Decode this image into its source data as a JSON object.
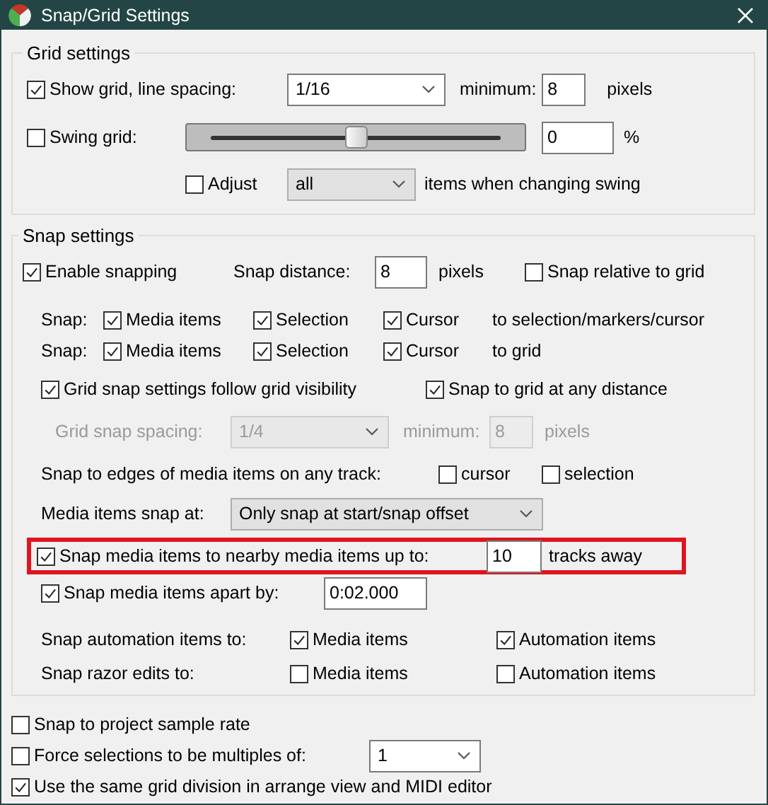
{
  "window": {
    "title": "Snap/Grid Settings"
  },
  "grid_settings": {
    "title": "Grid settings",
    "show_grid": {
      "label": "Show grid, line spacing:",
      "checked": true,
      "spacing": "1/16",
      "minimum_label": "minimum:",
      "minimum": "8",
      "unit": "pixels"
    },
    "swing": {
      "label": "Swing grid:",
      "checked": false,
      "level": 0.5,
      "value": "0",
      "unit": "%"
    },
    "adjust": {
      "label": "Adjust",
      "checked": false,
      "scope": "all",
      "suffix": "items when changing swing"
    }
  },
  "snap_settings": {
    "title": "Snap settings",
    "enable": {
      "label": "Enable snapping",
      "checked": true
    },
    "distance": {
      "label": "Snap distance:",
      "value": "8",
      "unit": "pixels"
    },
    "relative": {
      "label": "Snap relative to grid",
      "checked": false
    },
    "snap_rows": [
      {
        "label": "Snap:",
        "options": [
          {
            "label": "Media items",
            "checked": true
          },
          {
            "label": "Selection",
            "checked": true
          },
          {
            "label": "Cursor",
            "checked": true
          }
        ],
        "target": "to selection/markers/cursor"
      },
      {
        "label": "Snap:",
        "options": [
          {
            "label": "Media items",
            "checked": true
          },
          {
            "label": "Selection",
            "checked": true
          },
          {
            "label": "Cursor",
            "checked": true
          }
        ],
        "target": "to grid"
      }
    ],
    "follow_visibility": {
      "label": "Grid snap settings follow grid visibility",
      "checked": true
    },
    "any_distance": {
      "label": "Snap to grid at any distance",
      "checked": true
    },
    "grid_snap_spacing": {
      "label": "Grid snap spacing:",
      "value": "1/4",
      "minimum_label": "minimum:",
      "minimum": "8",
      "unit": "pixels",
      "disabled": true
    },
    "edges": {
      "label": "Snap to edges of media items on any track:",
      "options": [
        {
          "label": "cursor",
          "checked": false
        },
        {
          "label": "selection",
          "checked": false
        }
      ]
    },
    "snap_at": {
      "label": "Media items snap at:",
      "value": "Only snap at start/snap offset"
    },
    "nearby": {
      "label": "Snap media items to nearby media items up to:",
      "checked": true,
      "value": "10",
      "unit": "tracks away",
      "highlighted": true
    },
    "apart": {
      "label": "Snap media items apart by:",
      "checked": true,
      "value": "0:02.000"
    },
    "target_rows": [
      {
        "label": "Snap automation items to:",
        "options": [
          {
            "label": "Media items",
            "checked": true
          },
          {
            "label": "Automation items",
            "checked": true
          }
        ]
      },
      {
        "label": "Snap razor edits to:",
        "options": [
          {
            "label": "Media items",
            "checked": false
          },
          {
            "label": "Automation items",
            "checked": false
          }
        ]
      }
    ]
  },
  "bottom": [
    {
      "kind": "checkbox",
      "label": "Snap to project sample rate",
      "checked": false
    },
    {
      "kind": "checkbox-dropdown",
      "label": "Force selections to be multiples of:",
      "checked": false,
      "value": "1"
    },
    {
      "kind": "checkbox",
      "label": "Use the same grid division in arrange view and MIDI editor",
      "checked": true
    }
  ]
}
